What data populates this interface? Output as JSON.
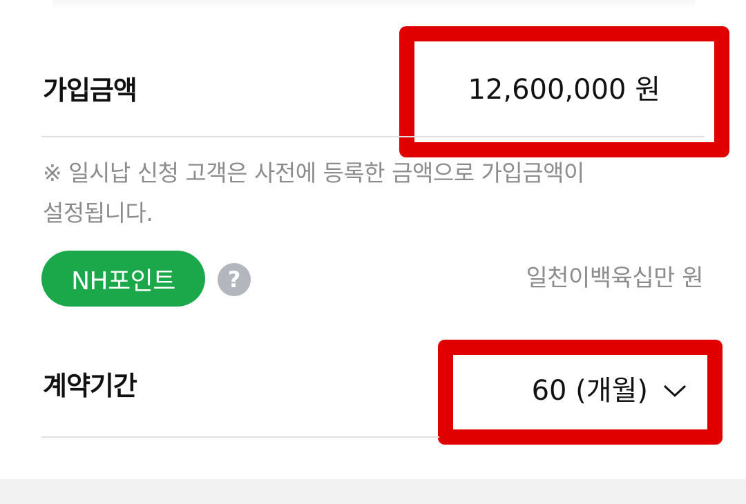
{
  "amount_row": {
    "label": "가입금액",
    "value": "12,600,000 원"
  },
  "notice": "※ 일시납 신청 고객은 사전에 등록한 금액으로 가입금액이 설정됩니다.",
  "points": {
    "badge_label": "NH포인트",
    "help_symbol": "?",
    "amount_in_korean": "일천이백육십만 원"
  },
  "period_row": {
    "label": "계약기간",
    "selected_value": "60 (개월)"
  },
  "colors": {
    "highlight_border": "#e00000",
    "badge_green": "#1ba84a",
    "help_gray": "#b3b6bc"
  },
  "icons": [
    "help-icon",
    "chevron-down-icon"
  ]
}
